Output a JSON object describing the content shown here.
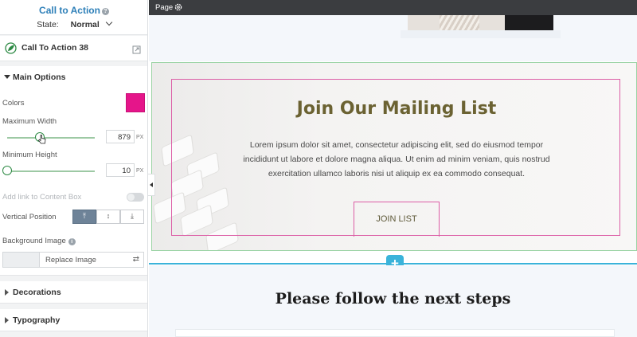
{
  "panel": {
    "title": "Call to Action",
    "state_label": "State:",
    "state_value": "Normal",
    "element_name": "Call To Action 38",
    "main_options": {
      "label": "Main Options",
      "colors_label": "Colors",
      "color_value": "#e5158a",
      "max_width_label": "Maximum Width",
      "max_width_value": "879",
      "max_width_unit": "PX",
      "min_height_label": "Minimum Height",
      "min_height_value": "10",
      "min_height_unit": "PX",
      "add_link_label": "Add link to Content Box",
      "vertical_position_label": "Vertical Position",
      "background_image_label": "Background Image",
      "replace_image_label": "Replace Image"
    },
    "decorations_label": "Decorations",
    "typography_label": "Typography"
  },
  "canvas": {
    "topbar_label": "Page",
    "cta": {
      "title": "Join Our Mailing List",
      "body": "Lorem ipsum dolor sit amet, consectetur adipiscing elit, sed do eiusmod tempor incididunt ut labore et dolore magna aliqua. Ut enim ad minim veniam, quis nostrud exercitation ullamco laboris nisi ut aliquip ex ea commodo consequat.",
      "button_label": "JOIN LIST"
    },
    "add_label": "+",
    "steps_heading": "Please follow the next steps"
  }
}
